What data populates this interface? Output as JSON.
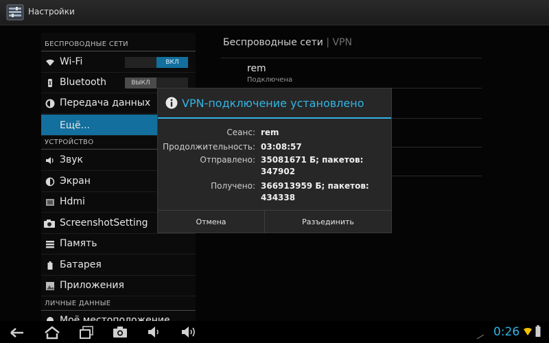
{
  "titlebar": {
    "title": "Настройки"
  },
  "sidebar": {
    "sections": [
      {
        "header": "БЕСПРОВОДНЫЕ СЕТИ"
      },
      {
        "header": "УСТРОЙСТВО"
      },
      {
        "header": "ЛИЧНЫЕ ДАННЫЕ"
      }
    ],
    "items": [
      {
        "label": "Wi-Fi",
        "icon": "wifi-icon",
        "toggle": "ВКЛ"
      },
      {
        "label": "Bluetooth",
        "icon": "bluetooth-icon",
        "toggle": "ВЫКЛ"
      },
      {
        "label": "Передача данных",
        "icon": "data-usage-icon"
      },
      {
        "label": "Ещё...",
        "selected": true
      },
      {
        "label": "Звук",
        "icon": "sound-icon"
      },
      {
        "label": "Экран",
        "icon": "display-icon"
      },
      {
        "label": "Hdmi",
        "icon": "hdmi-icon"
      },
      {
        "label": "ScreenshotSetting",
        "icon": "camera-icon"
      },
      {
        "label": "Память",
        "icon": "storage-icon"
      },
      {
        "label": "Батарея",
        "icon": "battery-icon"
      },
      {
        "label": "Приложения",
        "icon": "apps-icon"
      },
      {
        "label": "Моё местоположение",
        "icon": "location-icon"
      }
    ]
  },
  "content": {
    "title": "Беспроводные сети",
    "crumb": "VPN",
    "vpn_name": "rem",
    "vpn_status": "Подключена"
  },
  "dialog": {
    "title": "VPN-подключение установлено",
    "rows": [
      {
        "label": "Сеанс:",
        "value": "rem"
      },
      {
        "label": "Продолжительность:",
        "value": "03:08:57"
      },
      {
        "label": "Отправлено:",
        "value": "35081671 Б; пакетов: 347902"
      },
      {
        "label": "Получено:",
        "value": "366913959 Б; пакетов: 434338"
      }
    ],
    "cancel": "Отмена",
    "disconnect": "Разъединить"
  },
  "navbar": {
    "clock": "0:26"
  },
  "colors": {
    "accent": "#33b5e5",
    "selected": "#136f9d",
    "background": "#050505"
  }
}
